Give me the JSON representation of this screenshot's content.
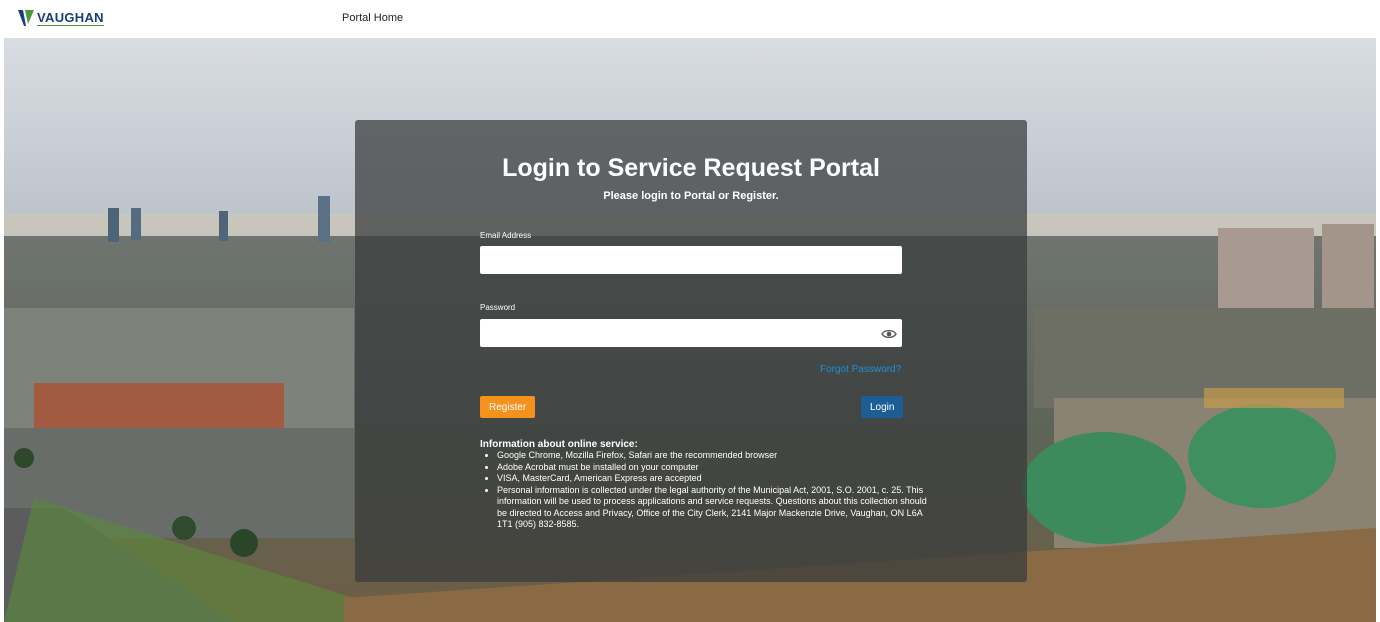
{
  "header": {
    "logo_text": "VAUGHAN",
    "nav_home": "Portal Home"
  },
  "login": {
    "title": "Login to Service Request Portal",
    "subtitle": "Please login to Portal or Register.",
    "email_label": "Email Address",
    "email_value": "",
    "password_label": "Password",
    "password_value": "",
    "forgot_link": "Forgot Password?",
    "register_button": "Register",
    "login_button": "Login"
  },
  "info": {
    "title": "Information about online service:",
    "items": [
      "Google Chrome, Mozilla Firefox, Safari are the recommended browser",
      "Adobe Acrobat must be installed on your computer",
      "VISA, MasterCard, American Express are accepted",
      "Personal information is collected under the legal authority of the Municipal Act, 2001, S.O. 2001, c. 25. This information will be used to process applications and service requests. Questions about this collection should be directed to Access and Privacy, Office of the City Clerk, 2141 Major Mackenzie Drive, Vaughan, ON L6A 1T1 (905) 832-8585."
    ]
  },
  "icons": {
    "logo": "vaughan-logo-icon",
    "password_toggle": "eye-icon"
  },
  "colors": {
    "brand_blue": "#1a3d7c",
    "brand_green": "#4a9a3a",
    "register_orange": "#f5921e",
    "login_blue": "#1d5d95",
    "link_blue": "#1e8fd8"
  }
}
